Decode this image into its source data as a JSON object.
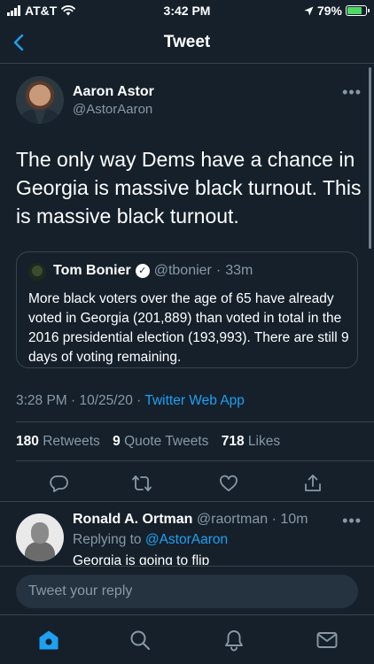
{
  "status_bar": {
    "carrier": "AT&T",
    "time": "3:42 PM",
    "battery": "79%",
    "battery_level": 0.79,
    "icons": [
      "signal-icon",
      "wifi-icon",
      "location-arrow-icon",
      "battery-charging-icon"
    ]
  },
  "header": {
    "title": "Tweet",
    "back_icon": "chevron-left-icon"
  },
  "tweet": {
    "author_name": "Aaron Astor",
    "author_handle": "@AstorAaron",
    "text": "The only way Dems have a chance in Georgia is massive black turnout. This is massive black turnout.",
    "quote": {
      "author_name": "Tom Bonier",
      "author_handle": "@tbonier",
      "time": "33m",
      "separator": "·",
      "text": "More black voters over the age of 65 have already voted in Georgia (201,889) than voted in total in the 2016 presidential election (193,993). There are still 9 days of voting remaining."
    },
    "timestamp": "3:28 PM · 10/25/20 ·",
    "source": "Twitter Web App",
    "stats": {
      "retweets_count": "180",
      "retweets_label": "Retweets",
      "quote_tweets_count": "9",
      "quote_tweets_label": "Quote Tweets",
      "likes_count": "718",
      "likes_label": "Likes"
    },
    "actions": [
      "reply-icon",
      "retweet-icon",
      "like-icon",
      "share-icon"
    ]
  },
  "reply": {
    "author_name": "Ronald A. Ortman",
    "author_handle": "@raortman",
    "time_text": "· 10m",
    "replying_to_label": "Replying to",
    "replying_to_handle": "@AstorAaron",
    "text": "Georgia is going to flip"
  },
  "composer": {
    "placeholder": "Tweet your reply",
    "value": ""
  },
  "tabs": [
    "home-icon",
    "search-icon",
    "notifications-icon",
    "messages-icon"
  ],
  "colors": {
    "background": "#15202b",
    "accent": "#1da1f2",
    "secondary_text": "#8899a6",
    "border": "#38444d"
  }
}
